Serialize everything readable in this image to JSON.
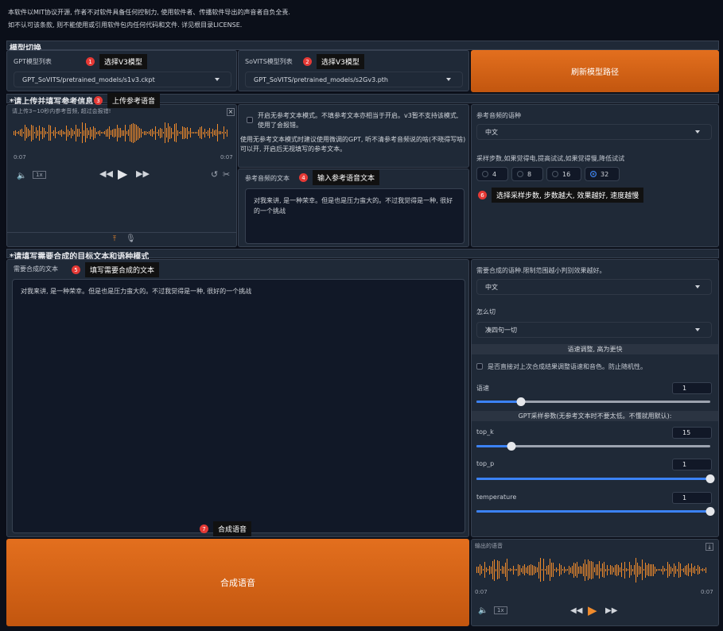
{
  "notice": {
    "line1": "本软件以MIT协议开源, 作者不对软件具备任何控制力, 使用软件者、传播软件导出的声音者自负全责.",
    "line2": "如不认可该条款, 则不能使用或引用软件包内任何代码和文件. 详见根目录LICENSE."
  },
  "model_section": {
    "title": "模型切换",
    "gpt_label": "GPT模型列表",
    "gpt_value": "GPT_SoVITS/pretrained_models/s1v3.ckpt",
    "sovits_label": "SoVITS模型列表",
    "sovits_value": "GPT_SoVITS/pretrained_models/s2Gv3.pth",
    "refresh_button": "刷新模型路径"
  },
  "ref_section": {
    "title": "*请上传并填写参考信息",
    "audio_label": "请上传3~10秒内参考音频, 超过会报错!",
    "time_start": "0:07",
    "time_end": "0:07",
    "speed_label": "1x",
    "no_ref_text": "开启无参考文本模式。不填参考文本亦相当于开启。v3暂不支持该模式, 使用了会报错。",
    "no_ref_hint": "使用无参考文本模式时建议使用微调的GPT, 听不清参考音频说的啥(不晓得写啥)可以开, 开启后无视填写的参考文本。",
    "ref_text_label": "参考音频的文本",
    "ref_text_value": "对我来讲, 是一种荣幸。但是也是压力蛮大的。不过我觉得是一种, 很好的一个挑战",
    "ref_lang_label": "参考音频的语种",
    "ref_lang_value": "中文",
    "steps_label": "采样步数,如果觉得电,提高试试,如果觉得慢,降低试试",
    "steps_options": [
      "4",
      "8",
      "16",
      "32"
    ],
    "steps_selected": "32"
  },
  "target_section": {
    "title": "*请填写需要合成的目标文本和语种模式",
    "text_label": "需要合成的文本",
    "text_value": "对我来讲, 是一种荣幸。但是也是压力蛮大的。不过我觉得是一种, 很好的一个挑战",
    "lang_label": "需要合成的语种.限制范围越小判别效果越好。",
    "lang_value": "中文",
    "cut_label": "怎么切",
    "cut_value": "凑四句一切",
    "speed_title": "语速调整, 高为更快",
    "resynth_label": "是否直接对上次合成结果调整语速和音色。防止随机性。",
    "speed_label": "语速",
    "speed_value": "1",
    "gpt_params_title": "GPT采样参数(无参考文本时不要太低。不懂就用默认):",
    "topk_label": "top_k",
    "topk_value": "15",
    "topp_label": "top_p",
    "topp_value": "1",
    "temp_label": "temperature",
    "temp_value": "1"
  },
  "sliders": {
    "speed": 0.19,
    "topk": 0.15,
    "topp": 1.0,
    "temp": 1.0
  },
  "synth_button": "合成语音",
  "output": {
    "label": "输出的语音",
    "time_start": "0:07",
    "time_end": "0:07",
    "speed_label": "1x"
  },
  "annotations": {
    "a1": {
      "num": "1",
      "text": "选择V3模型"
    },
    "a2": {
      "num": "2",
      "text": "选择V3模型"
    },
    "a3": {
      "num": "3",
      "text": "上传参考语音"
    },
    "a4": {
      "num": "4",
      "text": "输入参考语音文本"
    },
    "a5": {
      "num": "5",
      "text": "填写需要合成的文本"
    },
    "a6": {
      "num": "6",
      "text": "选择采样步数, 步数越大, 效果越好, 速度越慢"
    },
    "a7": {
      "num": "7",
      "text": "合成语音"
    }
  },
  "colors": {
    "accent": "#e36f1e",
    "slider": "#3b82f6",
    "badge": "#e53935"
  }
}
